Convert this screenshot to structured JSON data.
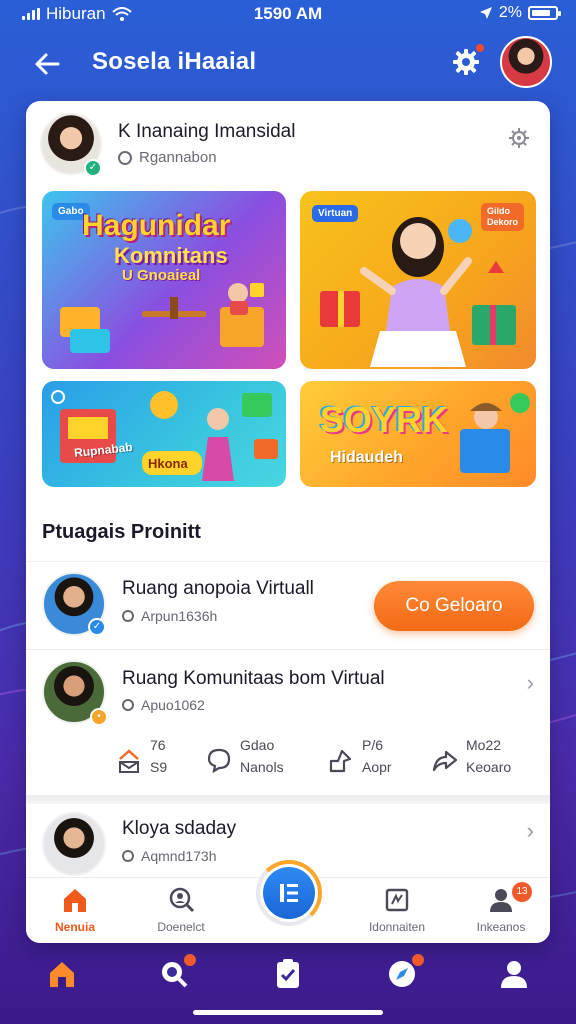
{
  "status_bar": {
    "carrier": "Hiburan",
    "time": "1590 AM",
    "battery": "2%"
  },
  "header": {
    "title": "Sosela iHaaial"
  },
  "profile": {
    "name": "K Inanaing Imansidal",
    "subtitle": "Rgannabon"
  },
  "tiles": [
    {
      "badge": "Gabo",
      "title": "Hagunidar",
      "subtitle1": "Komnitans",
      "subtitle2": "U Gnoaieal"
    },
    {
      "badge": "Virtuan",
      "badge2": "Gildo\nDekoro"
    },
    {
      "title": "Rupnabab",
      "subtitle": "Hkona"
    },
    {
      "title": "SOYRK",
      "subtitle": "Hidaudeh"
    }
  ],
  "section_title": "Ptuagais Proinitt",
  "rows": [
    {
      "name": "Ruang anopoia Virtuall",
      "subtitle": "Arpun1636h",
      "cta": "Co Geloaro"
    },
    {
      "name": "Ruang Komunitaas bom Virtual",
      "subtitle": "Apuo1062"
    },
    {
      "name": "Kloya sdaday",
      "subtitle": "Aqmnd173h"
    }
  ],
  "stats": [
    {
      "icon": "chart-icon",
      "line1": "76",
      "line2": "S9"
    },
    {
      "icon": "chat-icon",
      "line1": "Gdao",
      "line2": "Nanols"
    },
    {
      "icon": "share-icon",
      "line1": "P/6",
      "line2": "Aopr"
    },
    {
      "icon": "forward-icon",
      "line1": "Mo22",
      "line2": "Keoaro"
    }
  ],
  "tabbar": {
    "items": [
      {
        "label": "Nenuia",
        "icon": "home-icon",
        "active": true
      },
      {
        "label": "Doenelct",
        "icon": "search-person-icon",
        "active": false
      },
      {
        "label": "Idonnaiten",
        "icon": "document-icon",
        "active": false
      },
      {
        "label": "Inkeanos",
        "icon": "people-icon",
        "active": false,
        "badge": "13"
      }
    ]
  },
  "colors": {
    "accent": "#f26a14",
    "primary": "#1a66d8",
    "background_top": "#2a5fd6",
    "background_bottom": "#3a1a8a"
  }
}
